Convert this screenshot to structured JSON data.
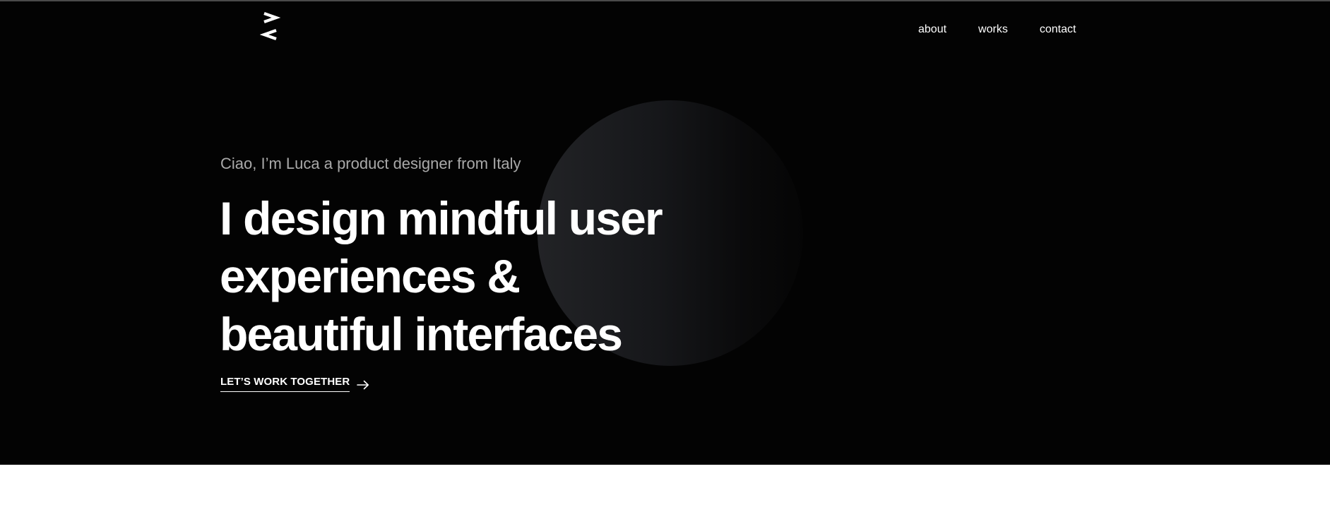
{
  "colors": {
    "hero_background": "#030303",
    "text_primary": "#ffffff",
    "text_secondary": "#a9a9a9",
    "page_background": "#ffffff",
    "circle_gradient_start": "#222326",
    "circle_gradient_end": "#050505"
  },
  "header": {
    "logo_icon": "chevron-logo-icon",
    "nav": [
      {
        "label": "about"
      },
      {
        "label": "works"
      },
      {
        "label": "contact"
      }
    ]
  },
  "hero": {
    "greeting": "Ciao, I’m Luca a product designer from Italy",
    "headline_lines": [
      "I design mindful user",
      "experiences &",
      "beautiful interfaces"
    ],
    "cta": {
      "label": "LET’S WORK TOGETHER",
      "icon": "arrow-right-icon"
    }
  }
}
